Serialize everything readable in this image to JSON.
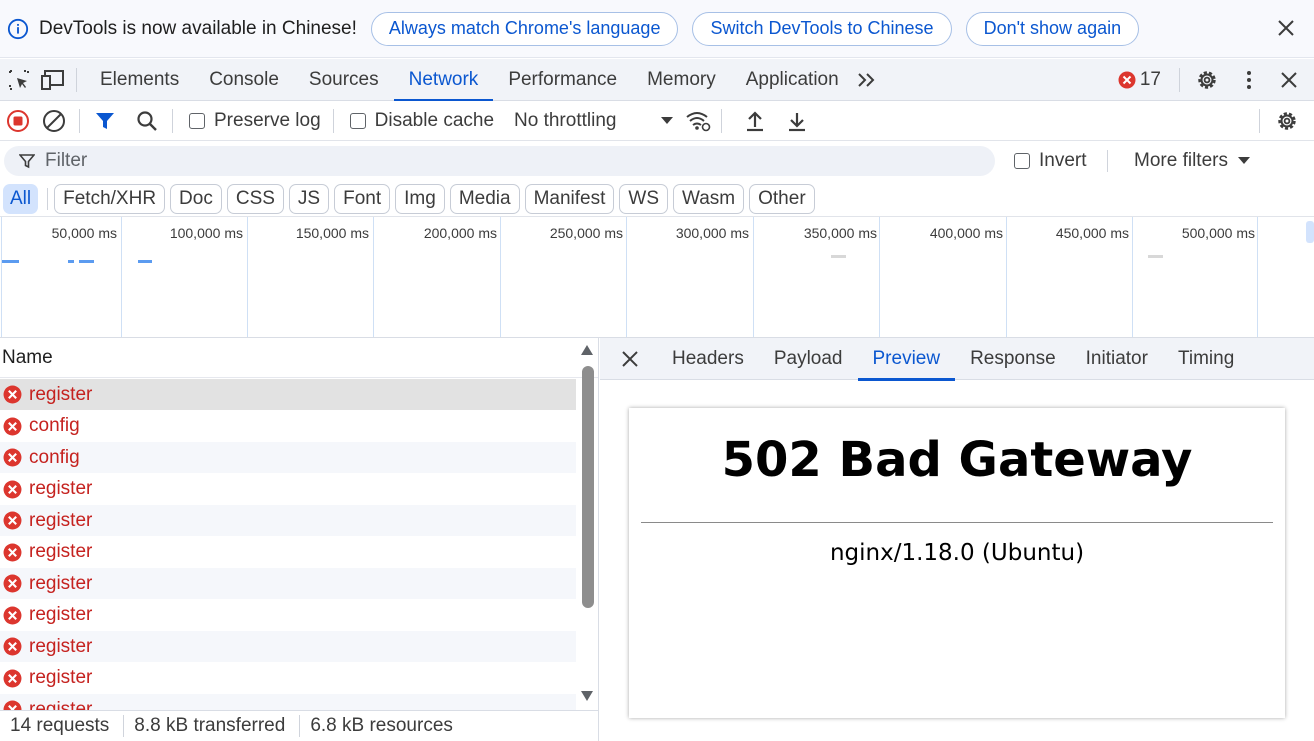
{
  "infobar": {
    "message": "DevTools is now available in Chinese!",
    "btn_match": "Always match Chrome's language",
    "btn_switch": "Switch DevTools to Chinese",
    "btn_dont": "Don't show again"
  },
  "main_tabs": {
    "elements": "Elements",
    "console": "Console",
    "sources": "Sources",
    "network": "Network",
    "performance": "Performance",
    "memory": "Memory",
    "application": "Application",
    "error_count": "17"
  },
  "toolbar": {
    "preserve_log": "Preserve log",
    "disable_cache": "Disable cache",
    "throttling": "No throttling"
  },
  "filter": {
    "placeholder": "Filter",
    "invert": "Invert",
    "more_filters": "More filters"
  },
  "chips": [
    "All",
    "Fetch/XHR",
    "Doc",
    "CSS",
    "JS",
    "Font",
    "Img",
    "Media",
    "Manifest",
    "WS",
    "Wasm",
    "Other"
  ],
  "overview": {
    "ticks": [
      "50,000 ms",
      "100,000 ms",
      "150,000 ms",
      "200,000 ms",
      "250,000 ms",
      "300,000 ms",
      "350,000 ms",
      "400,000 ms",
      "450,000 ms",
      "500,000 ms"
    ]
  },
  "requests": {
    "column_name": "Name",
    "rows": [
      "register",
      "config",
      "config",
      "register",
      "register",
      "register",
      "register",
      "register",
      "register",
      "register",
      "register"
    ]
  },
  "status": {
    "requests": "14 requests",
    "transferred": "8.8 kB transferred",
    "resources": "6.8 kB resources"
  },
  "detail_tabs": {
    "headers": "Headers",
    "payload": "Payload",
    "preview": "Preview",
    "response": "Response",
    "initiator": "Initiator",
    "timing": "Timing"
  },
  "preview": {
    "title": "502 Bad Gateway",
    "server": "nginx/1.18.0 (Ubuntu)"
  },
  "colors": {
    "accent": "#0b57d0",
    "error": "#c5221f"
  }
}
